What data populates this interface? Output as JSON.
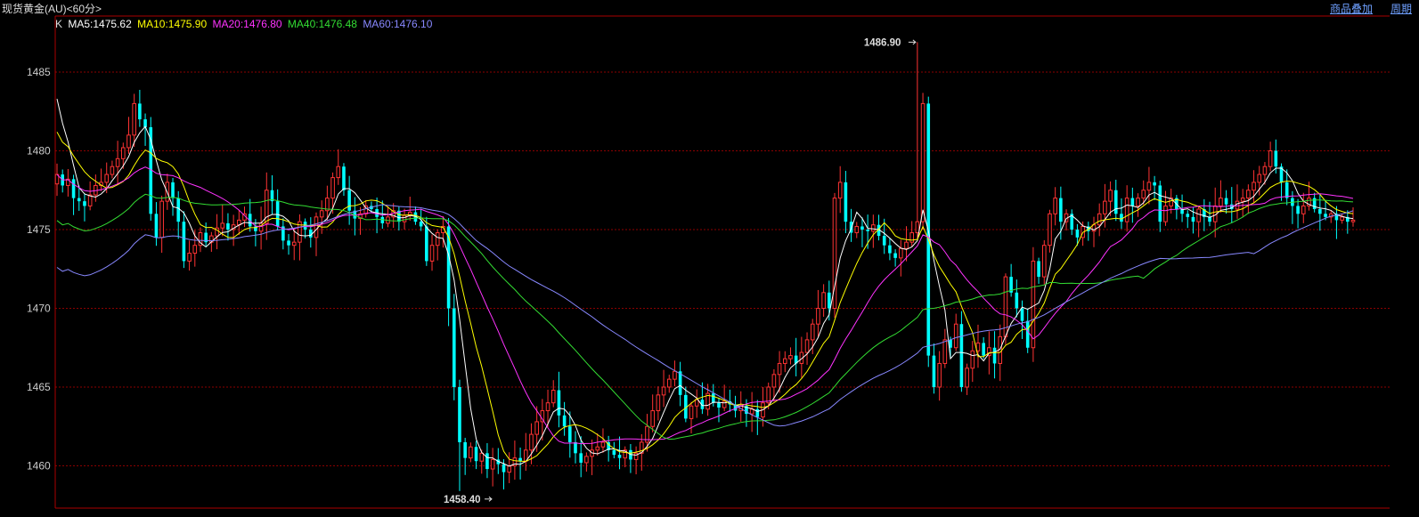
{
  "header": {
    "title": "现货黄金(AU)<60分>",
    "link_overlay": "商品叠加",
    "link_period": "周期"
  },
  "legend": {
    "prefix": "K",
    "items": [
      {
        "text": "MA5:1475.62",
        "color": "#ffffff"
      },
      {
        "text": "MA10:1475.90",
        "color": "#ffff00"
      },
      {
        "text": "MA20:1476.80",
        "color": "#ff33ff"
      },
      {
        "text": "MA40:1476.48",
        "color": "#33dd33"
      },
      {
        "text": "MA60:1476.10",
        "color": "#8888ff"
      }
    ]
  },
  "colors": {
    "up": "#ff3333",
    "down": "#00ffff",
    "grid": "#8b0000",
    "axis": "#aa0000",
    "text": "#cccccc"
  },
  "chart_data": {
    "type": "candlestick",
    "ylim": [
      1457,
      1488
    ],
    "yticks": [
      1460,
      1465,
      1470,
      1475,
      1480,
      1485
    ],
    "grid": true,
    "max_label": "1486.90",
    "max_value": 1486.9,
    "max_index": 156,
    "min_label": "1458.40",
    "min_value": 1458.4,
    "min_index": 73,
    "close": [
      1478.5,
      1477.8,
      1478.2,
      1477.0,
      1476.8,
      1476.5,
      1477.2,
      1477.8,
      1478.0,
      1478.5,
      1479.0,
      1479.5,
      1480.2,
      1481.0,
      1483.0,
      1482.0,
      1481.5,
      1476.0,
      1474.5,
      1476.8,
      1478.0,
      1477.0,
      1475.5,
      1473.0,
      1473.5,
      1474.0,
      1474.8,
      1474.2,
      1474.6,
      1475.1,
      1475.4,
      1475.0,
      1475.3,
      1475.6,
      1476.0,
      1475.2,
      1474.9,
      1475.4,
      1477.5,
      1476.8,
      1475.2,
      1474.3,
      1474.0,
      1474.2,
      1475.5,
      1475.0,
      1474.5,
      1475.8,
      1476.2,
      1477.0,
      1478.3,
      1479.0,
      1477.5,
      1476.2,
      1475.7,
      1476.0,
      1476.5,
      1476.3,
      1475.8,
      1475.4,
      1475.8,
      1476.2,
      1475.5,
      1475.9,
      1476.1,
      1475.5,
      1475.2,
      1473.0,
      1474.0,
      1474.8,
      1475.2,
      1470.0,
      1465.0,
      1461.5,
      1460.5,
      1461.2,
      1460.3,
      1460.8,
      1459.8,
      1460.4,
      1460.1,
      1459.6,
      1460.0,
      1460.5,
      1460.3,
      1461.0,
      1462.0,
      1462.8,
      1463.5,
      1464.0,
      1464.8,
      1463.2,
      1462.5,
      1461.5,
      1460.8,
      1460.2,
      1460.6,
      1461.0,
      1461.2,
      1461.5,
      1461.0,
      1460.7,
      1460.5,
      1461.0,
      1460.4,
      1460.8,
      1461.5,
      1462.5,
      1463.5,
      1464.5,
      1465.0,
      1465.5,
      1466.0,
      1464.5,
      1463.0,
      1463.8,
      1464.2,
      1463.6,
      1464.6,
      1464.0,
      1463.7,
      1464.1,
      1463.9,
      1463.5,
      1463.8,
      1463.3,
      1463.6,
      1463.1,
      1464.0,
      1465.0,
      1465.8,
      1466.5,
      1466.8,
      1467.0,
      1466.5,
      1467.2,
      1468.0,
      1469.0,
      1470.0,
      1471.0,
      1470.0,
      1477.0,
      1478.0,
      1475.5,
      1474.8,
      1475.2,
      1475.0,
      1474.9,
      1475.3,
      1474.6,
      1474.0,
      1473.5,
      1473.2,
      1473.8,
      1474.2,
      1474.8,
      1475.5,
      1483.0,
      1467.0,
      1465.0,
      1466.5,
      1468.0,
      1467.5,
      1469.0,
      1465.0,
      1466.2,
      1467.3,
      1467.8,
      1467.0,
      1467.5,
      1466.5,
      1468.2,
      1472.0,
      1471.0,
      1470.0,
      1469.2,
      1467.5,
      1473.0,
      1472.0,
      1474.0,
      1476.0,
      1477.0,
      1475.5,
      1476.0,
      1475.0,
      1474.5,
      1475.2,
      1474.9,
      1475.3,
      1476.0,
      1476.8,
      1477.5,
      1476.0,
      1475.5,
      1477.0,
      1476.5,
      1477.0,
      1477.5,
      1478.0,
      1477.8,
      1475.5,
      1476.5,
      1477.0,
      1476.3,
      1476.0,
      1475.8,
      1475.5,
      1476.3,
      1475.8,
      1475.5,
      1476.5,
      1477.0,
      1476.6,
      1476.3,
      1476.8,
      1477.0,
      1477.5,
      1478.0,
      1478.5,
      1479.0,
      1480.0,
      1479.0,
      1478.0,
      1477.0,
      1476.5,
      1476.0,
      1476.5,
      1477.0,
      1476.3,
      1476.0,
      1475.8,
      1476.0,
      1475.6,
      1475.8,
      1475.5,
      1475.6
    ]
  }
}
